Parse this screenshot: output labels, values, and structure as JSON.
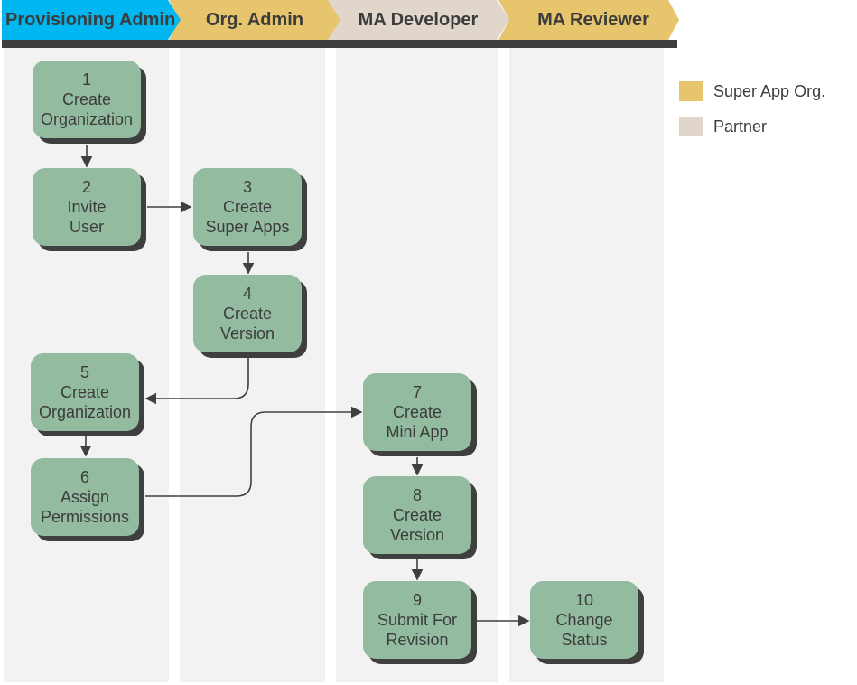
{
  "lanes": [
    {
      "label": "Provisioning Admin",
      "color": "#00b7f1"
    },
    {
      "label": "Org. Admin",
      "color": "#e6c56d"
    },
    {
      "label": "MA Developer",
      "color": "#e0d6cc"
    },
    {
      "label": "MA Reviewer",
      "color": "#e6c56d"
    }
  ],
  "steps": [
    {
      "num": "1",
      "line1": "Create",
      "line2": "Organization"
    },
    {
      "num": "2",
      "line1": "Invite",
      "line2": "User"
    },
    {
      "num": "3",
      "line1": "Create",
      "line2": "Super Apps"
    },
    {
      "num": "4",
      "line1": "Create",
      "line2": "Version"
    },
    {
      "num": "5",
      "line1": "Create",
      "line2": "Organization"
    },
    {
      "num": "6",
      "line1": "Assign",
      "line2": "Permissions"
    },
    {
      "num": "7",
      "line1": "Create",
      "line2": "Mini App"
    },
    {
      "num": "8",
      "line1": "Create",
      "line2": "Version"
    },
    {
      "num": "9",
      "line1": "Submit For",
      "line2": "Revision"
    },
    {
      "num": "10",
      "line1": "Change",
      "line2": "Status"
    }
  ],
  "legend": [
    {
      "label": "Super App Org.",
      "color": "#e6c56d"
    },
    {
      "label": "Partner",
      "color": "#e0d6cc"
    }
  ]
}
